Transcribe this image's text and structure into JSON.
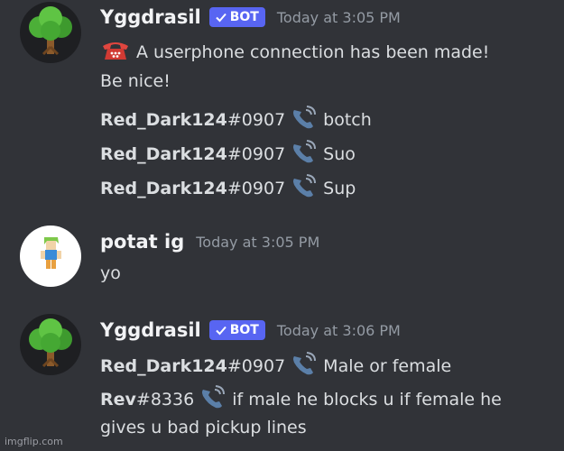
{
  "messages": [
    {
      "author": "Yggdrasil",
      "bot_label": "BOT",
      "timestamp": "Today at 3:05 PM",
      "avatar": "tree-avatar",
      "lines": [
        {
          "icon": "red-telephone-icon",
          "text": "A userphone connection has been made!"
        },
        {
          "text": "Be nice!"
        },
        {
          "user": "Red_Dark124",
          "tag": "#0907",
          "icon": "phone-icon",
          "text": "botch"
        },
        {
          "user": "Red_Dark124",
          "tag": "#0907",
          "icon": "phone-icon",
          "text": "Suo"
        },
        {
          "user": "Red_Dark124",
          "tag": "#0907",
          "icon": "phone-icon",
          "text": "Sup"
        }
      ]
    },
    {
      "author": "potat ig",
      "timestamp": "Today at 3:05 PM",
      "avatar": "character-avatar",
      "lines": [
        {
          "text": "yo"
        }
      ]
    },
    {
      "author": "Yggdrasil",
      "bot_label": "BOT",
      "timestamp": "Today at 3:06 PM",
      "avatar": "tree-avatar",
      "lines": [
        {
          "user": "Red_Dark124",
          "tag": "#0907",
          "icon": "phone-icon",
          "text": "Male or female"
        },
        {
          "user": "Rev",
          "tag": "#8336",
          "icon": "phone-icon",
          "text": "if male he blocks u if female he"
        },
        {
          "text": "gives u bad pickup lines"
        }
      ]
    }
  ],
  "watermark": "imgflip.com",
  "colors": {
    "background": "#313338",
    "bot_badge": "#5865f2",
    "username": "#f2f3f5",
    "timestamp": "#949ba4",
    "text": "#dbdee1"
  }
}
